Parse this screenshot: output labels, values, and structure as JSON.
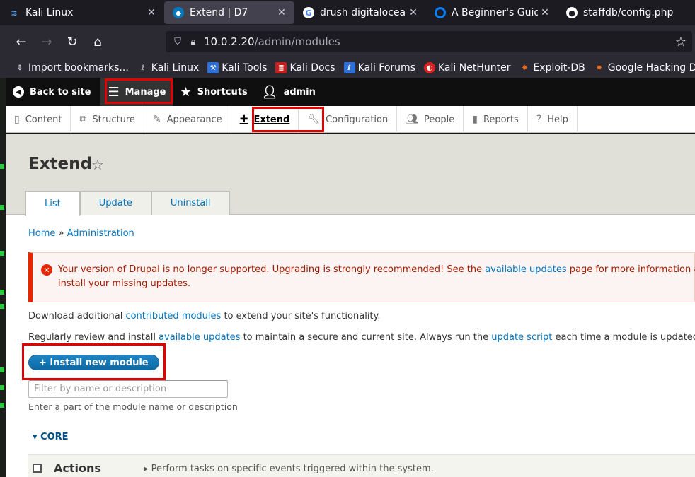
{
  "browser": {
    "tabs": [
      {
        "label": "Kali Linux",
        "icon": "kali-icon",
        "active": false
      },
      {
        "label": "Extend | D7",
        "icon": "drupal-icon",
        "active": true
      },
      {
        "label": "drush digitalocean",
        "icon": "google-icon",
        "active": false
      },
      {
        "label": "A Beginner's Guide",
        "icon": "digitalocean-icon",
        "active": false
      },
      {
        "label": "staffdb/config.php",
        "icon": "github-icon",
        "active": false
      }
    ],
    "url_host": "10.0.2.20",
    "url_path": "/admin/modules",
    "bookmarks": [
      {
        "label": "Import bookmarks...",
        "icon": "import-icon"
      },
      {
        "label": "Kali Linux",
        "icon": "kali-icon"
      },
      {
        "label": "Kali Tools",
        "icon": "kali-tools-icon"
      },
      {
        "label": "Kali Docs",
        "icon": "kali-docs-icon"
      },
      {
        "label": "Kali Forums",
        "icon": "kali-forums-icon"
      },
      {
        "label": "Kali NetHunter",
        "icon": "nethunter-icon"
      },
      {
        "label": "Exploit-DB",
        "icon": "exploit-db-icon"
      },
      {
        "label": "Google Hacking DB",
        "icon": "ghdb-icon"
      }
    ]
  },
  "toolbar": {
    "back": "Back to site",
    "manage": "Manage",
    "shortcuts": "Shortcuts",
    "user": "admin"
  },
  "tray": {
    "items": [
      {
        "label": "Content",
        "icon": "content-icon"
      },
      {
        "label": "Structure",
        "icon": "structure-icon"
      },
      {
        "label": "Appearance",
        "icon": "appearance-icon"
      },
      {
        "label": "Extend",
        "icon": "extend-icon"
      },
      {
        "label": "Configuration",
        "icon": "configuration-icon"
      },
      {
        "label": "People",
        "icon": "people-icon"
      },
      {
        "label": "Reports",
        "icon": "reports-icon"
      },
      {
        "label": "Help",
        "icon": "help-icon"
      }
    ]
  },
  "page": {
    "title": "Extend",
    "tabs": [
      "List",
      "Update",
      "Uninstall"
    ],
    "breadcrumb": {
      "home": "Home",
      "sep": "»",
      "admin": "Administration"
    },
    "message": {
      "line1_pre": "Your version of Drupal is no longer supported. Upgrading is strongly recommended! See the ",
      "line1_link": "available updates",
      "line1_post": " page for more information and",
      "line2": "install your missing updates."
    },
    "p1_pre": "Download additional ",
    "p1_link": "contributed modules",
    "p1_post": " to extend your site's functionality.",
    "p2_pre": "Regularly review and install ",
    "p2_link1": "available updates",
    "p2_mid": " to maintain a secure and current site. Always run the ",
    "p2_link2": "update script",
    "p2_post": " each time a module is updated.",
    "install_label": "+ Install new module",
    "filter_placeholder": "Filter by name or description",
    "filter_description": "Enter a part of the module name or description",
    "core_label": "▾ CORE",
    "module": {
      "name": "Actions",
      "description": "▸ Perform tasks on specific events triggered within the system."
    }
  },
  "colors": {
    "link": "#0074bd",
    "error": "#e62600",
    "highlight": "#e50000"
  }
}
